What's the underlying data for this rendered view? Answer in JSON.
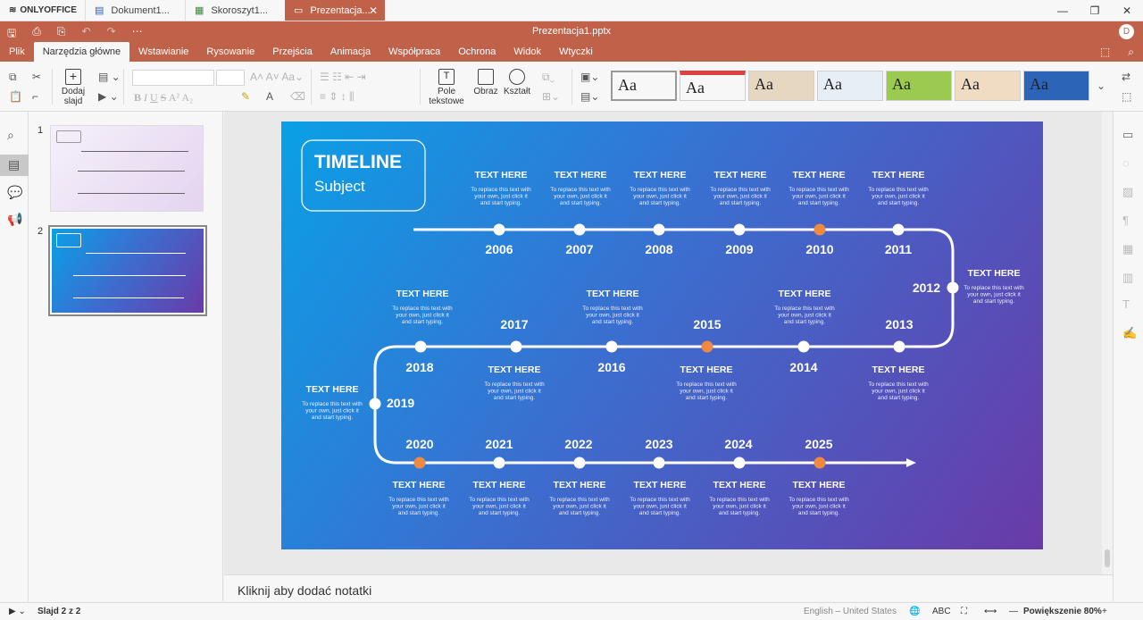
{
  "app": {
    "logo": "ONLYOFFICE",
    "window_title": "Prezentacja1.pptx",
    "avatar_letter": "D"
  },
  "tabs": [
    {
      "label": "Dokument1...",
      "icon": "document-icon"
    },
    {
      "label": "Skoroszyt1...",
      "icon": "spreadsheet-icon"
    },
    {
      "label": "Prezentacja...",
      "icon": "presentation-icon",
      "active": true
    }
  ],
  "menu": {
    "items": [
      "Plik",
      "Narzędzia główne",
      "Wstawianie",
      "Rysowanie",
      "Przejścia",
      "Animacja",
      "Współpraca",
      "Ochrona",
      "Widok",
      "Wtyczki"
    ],
    "active": "Narzędzia główne"
  },
  "toolbar": {
    "add_slide_line1": "Dodaj",
    "add_slide_line2": "slajd",
    "textbox_line1": "Pole",
    "textbox_line2": "tekstowe",
    "image_label": "Obraz",
    "shape_label": "Kształt",
    "theme_sample": "Aa",
    "theme_colors": [
      "#ffffff",
      "#ffffff",
      "#e6d8c0",
      "#e7eef6",
      "#9acb50",
      "#efdcc2",
      "#2c64b8"
    ]
  },
  "thumbnails": [
    {
      "number": "1"
    },
    {
      "number": "2",
      "selected": true
    }
  ],
  "slide": {
    "title": "TIMELINE",
    "subtitle": "Subject",
    "heading": "TEXT HERE",
    "body_line1": "To replace this text with",
    "body_line2": "your own, just click it",
    "body_line3": "and start typing.",
    "years": [
      "2006",
      "2007",
      "2008",
      "2009",
      "2010",
      "2011",
      "2012",
      "2013",
      "2014",
      "2015",
      "2016",
      "2017",
      "2018",
      "2019",
      "2020",
      "2021",
      "2022",
      "2023",
      "2024",
      "2025"
    ],
    "highlighted": [
      "2010",
      "2015",
      "2020",
      "2025"
    ],
    "accent_color": "#f08a40"
  },
  "notes": {
    "placeholder": "Kliknij aby dodać notatki"
  },
  "status": {
    "slide_counter": "Slajd 2 z 2",
    "language": "English – United States",
    "zoom": "Powiększenie 80%"
  }
}
